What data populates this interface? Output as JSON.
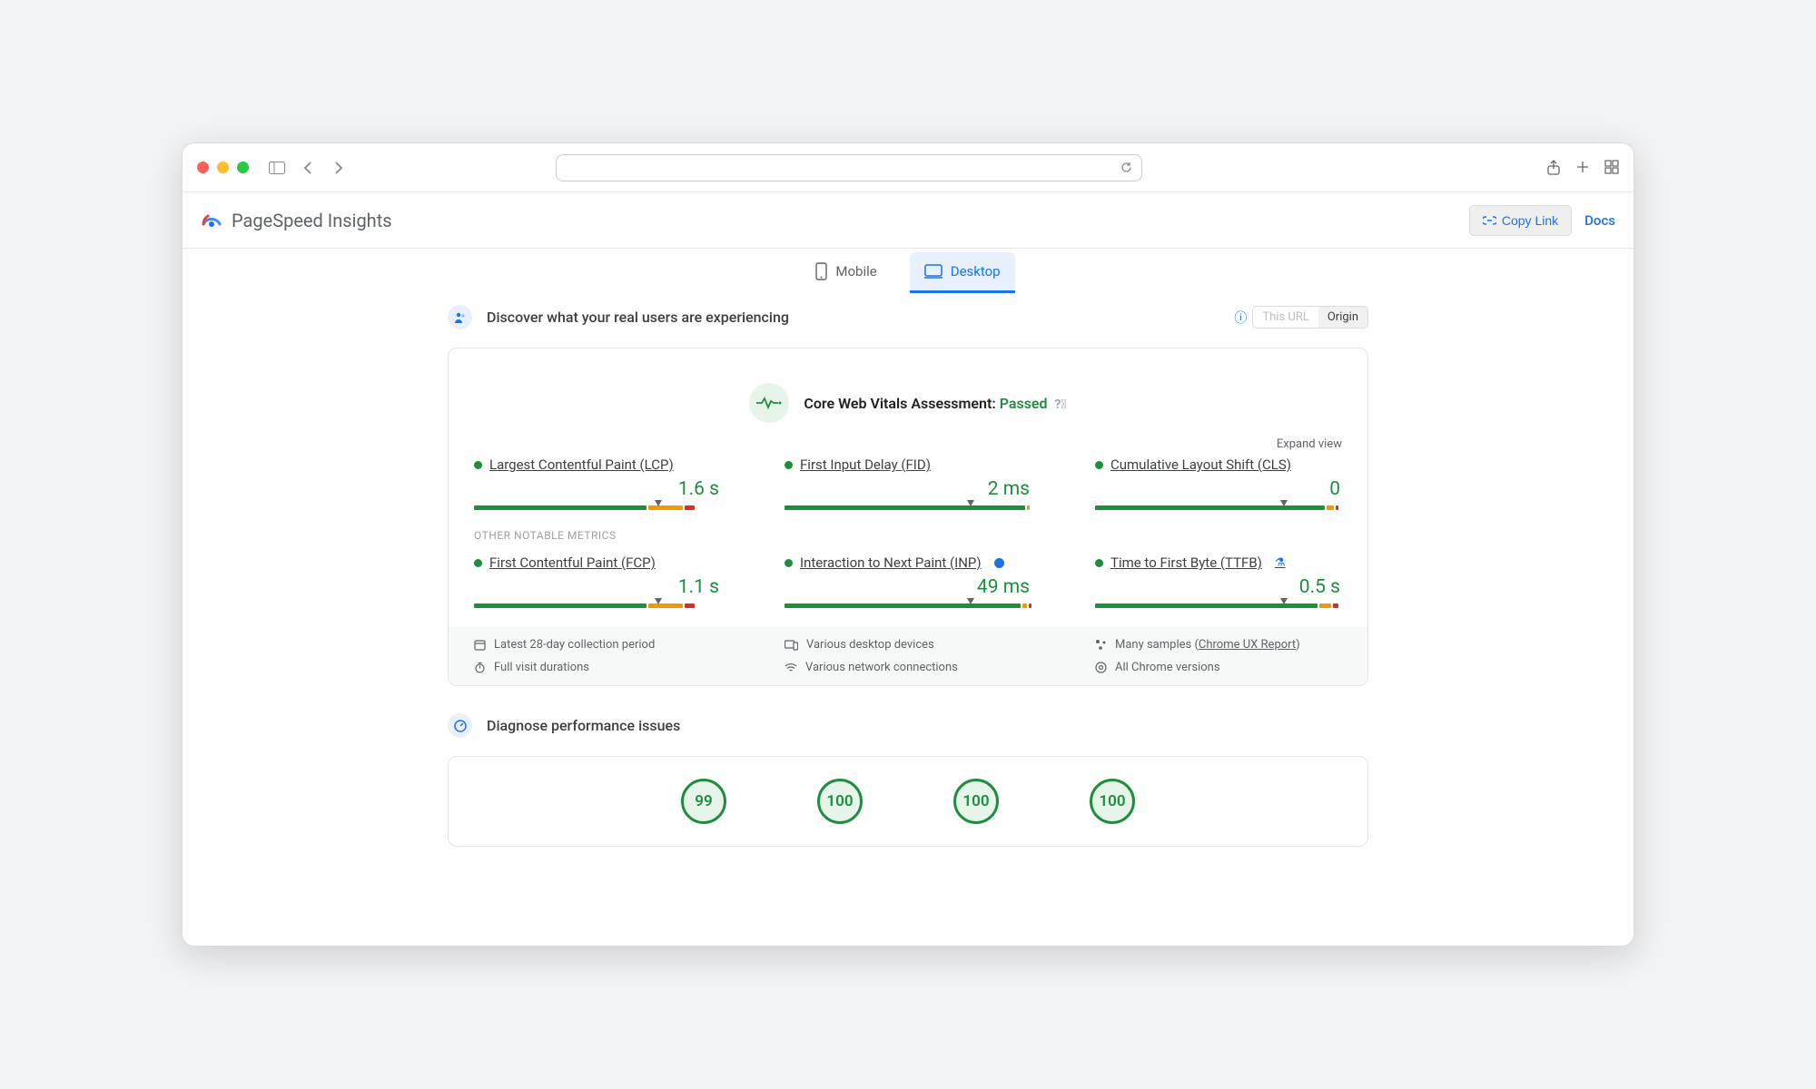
{
  "app": {
    "title": "PageSpeed Insights",
    "copy_link": "Copy Link",
    "docs": "Docs"
  },
  "tabs": {
    "mobile": "Mobile",
    "desktop": "Desktop"
  },
  "section1": {
    "title": "Discover what your real users are experiencing",
    "scope": {
      "this_url": "This URL",
      "origin": "Origin"
    }
  },
  "cwv": {
    "label": "Core Web Vitals Assessment:",
    "status": "Passed",
    "expand": "Expand view"
  },
  "metrics_main": [
    {
      "name": "Largest Contentful Paint (LCP)",
      "value": "1.6 s",
      "marker": 73,
      "segs": [
        70,
        6,
        14,
        6,
        4
      ]
    },
    {
      "name": "First Input Delay (FID)",
      "value": "2 ms",
      "marker": 74,
      "segs": [
        98,
        1,
        1,
        0,
        0
      ]
    },
    {
      "name": "Cumulative Layout Shift (CLS)",
      "value": "0",
      "marker": 75,
      "segs": [
        93,
        2,
        3,
        1,
        1
      ]
    }
  ],
  "other_heading": "OTHER NOTABLE METRICS",
  "metrics_other": [
    {
      "name": "First Contentful Paint (FCP)",
      "value": "1.1 s",
      "marker": 73,
      "segs": [
        70,
        6,
        14,
        6,
        4
      ],
      "badge": ""
    },
    {
      "name": "Interaction to Next Paint (INP)",
      "value": "49 ms",
      "marker": 74,
      "segs": [
        96,
        1,
        2,
        0,
        1
      ],
      "badge": "info"
    },
    {
      "name": "Time to First Byte (TTFB)",
      "value": "0.5 s",
      "marker": 75,
      "segs": [
        90,
        2,
        5,
        1,
        2
      ],
      "badge": "beaker"
    }
  ],
  "summary": {
    "a1": "Latest 28-day collection period",
    "a2": "Various desktop devices",
    "a3_pre": "Many samples (",
    "a3_link": "Chrome UX Report",
    "a3_post": ")",
    "b1": "Full visit durations",
    "b2": "Various network connections",
    "b3": "All Chrome versions"
  },
  "section2": {
    "title": "Diagnose performance issues"
  },
  "scores": [
    "99",
    "100",
    "100",
    "100"
  ]
}
